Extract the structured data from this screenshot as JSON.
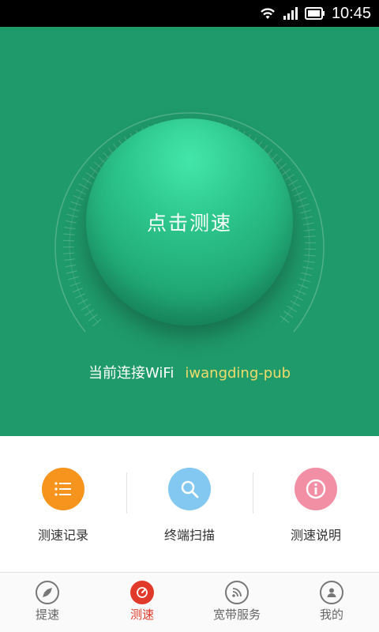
{
  "status_bar": {
    "time": "10:45"
  },
  "hero": {
    "start_button": "点击测速",
    "wifi_prefix": "当前连接WiFi",
    "wifi_ssid": "iwangding-pub"
  },
  "actions": [
    {
      "label": "测速记录",
      "icon": "list-icon",
      "color": "#f7941d"
    },
    {
      "label": "终端扫描",
      "icon": "search-icon",
      "color": "#82c8f0"
    },
    {
      "label": "测速说明",
      "icon": "info-icon",
      "color": "#f28fa5"
    }
  ],
  "nav": [
    {
      "label": "提速",
      "icon": "rocket-icon",
      "active": false
    },
    {
      "label": "测速",
      "icon": "speedometer-icon",
      "active": true
    },
    {
      "label": "宽带服务",
      "icon": "rss-icon",
      "active": false
    },
    {
      "label": "我的",
      "icon": "user-icon",
      "active": false
    }
  ],
  "colors": {
    "hero_bg": "#1f9a6b",
    "accent": "#e23a2a",
    "ssid": "#f1dc6a"
  }
}
